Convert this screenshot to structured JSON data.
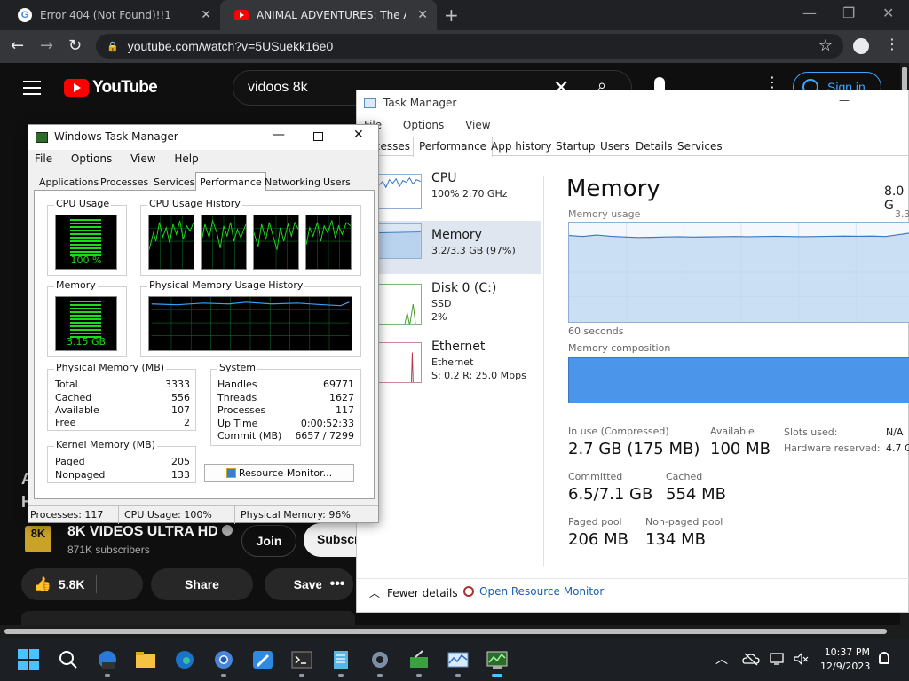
{
  "browser": {
    "tabs": [
      {
        "title": "Error 404 (Not Found)!!1",
        "favicon": "google-icon",
        "active": false
      },
      {
        "title": "ANIMAL ADVENTURES: The Ama",
        "favicon": "youtube-icon",
        "active": true
      }
    ],
    "url": "youtube.com/watch?v=5USuekk16e0",
    "glyphs": {
      "close": "✕",
      "new_tab": "+",
      "back": "←",
      "forward": "→",
      "reload": "↻",
      "star": "☆",
      "kebab": "⋮",
      "minimize": "—",
      "restore": "❐",
      "lock": "🔒"
    }
  },
  "youtube": {
    "search_query": "vidoos 8k",
    "signin_label": "Sign in",
    "channel": {
      "logo_text": "8K",
      "name": "8K VIDEOS ULTRA HD",
      "subscribers": "871K subscribers"
    },
    "join_label": "Join",
    "subscribe_label": "Subscr",
    "like_count": "5.8K",
    "share_label": "Share",
    "save_label": "Save",
    "more_label": "•••",
    "dim_text": "A H"
  },
  "taskmgr_win11": {
    "title": "Task Manager",
    "menu": [
      "File",
      "Options",
      "View"
    ],
    "tabs": [
      "Processes",
      "Performance",
      "App history",
      "Startup",
      "Users",
      "Details",
      "Services"
    ],
    "active_tab": "Performance",
    "sidebar": [
      {
        "name": "CPU",
        "line1": "100% 2.70 GHz",
        "line2": ""
      },
      {
        "name": "Memory",
        "line1": "3.2/3.3 GB (97%)",
        "line2": ""
      },
      {
        "name": "Disk 0 (C:)",
        "line1": "SSD",
        "line2": "2%"
      },
      {
        "name": "Ethernet",
        "line1": "Ethernet",
        "line2": "S: 0.2  R: 25.0 Mbps"
      }
    ],
    "selected": "Memory",
    "memory": {
      "heading": "Memory",
      "total": "8.0 G",
      "usage_label": "Memory usage",
      "usage_max": "3.3",
      "seconds_label": "60 seconds",
      "composition_label": "Memory composition",
      "usage_level": 0.87,
      "stats": {
        "in_use_label": "In use (Compressed)",
        "in_use": "2.7 GB (175 MB)",
        "available_label": "Available",
        "available": "100 MB",
        "committed_label": "Committed",
        "committed": "6.5/7.1 GB",
        "cached_label": "Cached",
        "cached": "554 MB",
        "paged_label": "Paged pool",
        "paged": "206 MB",
        "nonpaged_label": "Non-paged pool",
        "nonpaged": "134 MB",
        "slots_label": "Slots used:",
        "slots": "N/A",
        "hw_label": "Hardware reserved:",
        "hw": "4.7 G"
      }
    },
    "fewer_details": "Fewer details",
    "open_resource_monitor": "Open Resource Monitor",
    "glyphs": {
      "chevron": "︿",
      "minimize": "—"
    }
  },
  "taskmgr_classic": {
    "title": "Windows Task Manager",
    "menu": [
      "File",
      "Options",
      "View",
      "Help"
    ],
    "tabs": [
      "Applications",
      "Processes",
      "Services",
      "Performance",
      "Networking",
      "Users"
    ],
    "active_tab": "Performance",
    "cpu_usage_label": "CPU Usage",
    "cpu_usage_value": "100 %",
    "cpu_history_label": "CPU Usage History",
    "memory_label": "Memory",
    "memory_value": "3.15 GB",
    "phys_history_label": "Physical Memory Usage History",
    "physical": {
      "label": "Physical Memory (MB)",
      "rows": [
        [
          "Total",
          "3333"
        ],
        [
          "Cached",
          "556"
        ],
        [
          "Available",
          "107"
        ],
        [
          "Free",
          "2"
        ]
      ]
    },
    "system": {
      "label": "System",
      "rows": [
        [
          "Handles",
          "69771"
        ],
        [
          "Threads",
          "1627"
        ],
        [
          "Processes",
          "117"
        ],
        [
          "Up Time",
          "0:00:52:33"
        ],
        [
          "Commit (MB)",
          "6657 / 7299"
        ]
      ]
    },
    "kernel": {
      "label": "Kernel Memory (MB)",
      "rows": [
        [
          "Paged",
          "205"
        ],
        [
          "Nonpaged",
          "133"
        ]
      ]
    },
    "resource_monitor": "Resource Monitor...",
    "status": {
      "processes": "Processes: 117",
      "cpu": "CPU Usage: 100%",
      "memory": "Physical Memory: 96%"
    },
    "cpu_level": 1.0,
    "memory_level": 0.96,
    "glyphs": {
      "minimize": "—",
      "close": "✕"
    }
  },
  "taskbar": {
    "icons": [
      "start-icon",
      "search-icon",
      "edge-dev-icon",
      "file-explorer-icon",
      "edge-icon",
      "chrome-icon",
      "paint-icon",
      "terminal-icon",
      "notepad-icon",
      "settings-icon",
      "tool-icon",
      "task-monitor-icon",
      "task-manager-icon"
    ],
    "time": "10:37 PM",
    "date": "12/9/2023",
    "tray_glyphs": {
      "chevron": "︿"
    }
  },
  "colors": {
    "youtube_red": "#ff0000",
    "meter_green": "#1bdc1b",
    "memory_blue": "#4b95ea",
    "link_blue": "#1a5fb4",
    "chrome_dark": "#202124"
  }
}
